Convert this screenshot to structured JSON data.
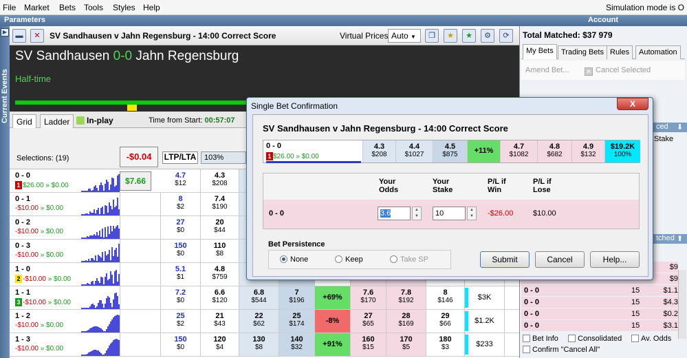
{
  "menu": [
    "File",
    "Market",
    "Bets",
    "Tools",
    "Styles",
    "Help"
  ],
  "menu_status": "Simulation mode is O",
  "panels": {
    "parameters": "Parameters",
    "account": "Account",
    "current_events": "Current Events"
  },
  "toolbar": {
    "title": "SV Sandhausen v Jahn Regensburg - 14:00 Correct Score",
    "virtual_prices_label": "Virtual Prices:",
    "virtual_prices_value": "Auto"
  },
  "event": {
    "home": "SV Sandhausen",
    "score": "0-0",
    "away": "Jahn Regensburg",
    "status": "Half-time"
  },
  "tabs": {
    "grid": "Grid",
    "ladder": "Ladder",
    "inplay": "In-play",
    "time_label": "Time from Start:",
    "time_value": "00:57:07"
  },
  "grid_header": {
    "selections": "Selections: (19)",
    "pl": "-$0.04",
    "ltp_lta": "LTP/LTA",
    "pct": "103%"
  },
  "rows": [
    {
      "name": "0 - 0",
      "badge": "1",
      "badge_color": "#cc0000",
      "pl_from": "$26.00",
      "pl_to": "$0.00",
      "pl_neg": false,
      "pbtn": "$7.66",
      "ltp": "4.7",
      "ltp_amt": "$12",
      "c1": "4.3",
      "c1a": "$208",
      "c2": "",
      "c2a": "",
      "c3": "",
      "c3a": "",
      "pct": "",
      "l1": "",
      "l1a": "",
      "l2": "",
      "l2a": "",
      "l3": "",
      "l3a": "",
      "matched": ""
    },
    {
      "name": "0 - 1",
      "badge": "",
      "pl_from": "-$10.00",
      "pl_to": "$0.00",
      "pl_neg": true,
      "ltp": "8",
      "ltp_amt": "$2",
      "c1": "7.4",
      "c1a": "$190",
      "matched": ""
    },
    {
      "name": "0 - 2",
      "badge": "",
      "pl_from": "-$10.00",
      "pl_to": "$0.00",
      "pl_neg": true,
      "ltp": "27",
      "ltp_amt": "$0",
      "c1": "20",
      "c1a": "$44",
      "matched": ""
    },
    {
      "name": "0 - 3",
      "badge": "",
      "pl_from": "-$10.00",
      "pl_to": "$0.00",
      "pl_neg": true,
      "ltp": "150",
      "ltp_amt": "$0",
      "c1": "110",
      "c1a": "$8",
      "matched": ""
    },
    {
      "name": "1 - 0",
      "badge": "2",
      "badge_color": "#ffe400",
      "pl_from": "-$10.00",
      "pl_to": "$0.00",
      "pl_neg": true,
      "ltp": "5.1",
      "ltp_amt": "$1",
      "c1": "4.8",
      "c1a": "$759",
      "matched": ""
    },
    {
      "name": "1 - 1",
      "badge": "3",
      "badge_color": "#1a9a1a",
      "pl_from": "-$10.00",
      "pl_to": "$0.00",
      "pl_neg": true,
      "ltp": "7.2",
      "ltp_amt": "$0",
      "c1": "6.6",
      "c1a": "$120",
      "c2": "6.8",
      "c2a": "$544",
      "c3": "7",
      "c3a": "$196",
      "pct": "+69%",
      "pct_type": "gr",
      "l1": "7.6",
      "l1a": "$170",
      "l2": "7.8",
      "l2a": "$192",
      "l3": "8",
      "l3a": "$146",
      "matched": "$3K"
    },
    {
      "name": "1 - 2",
      "badge": "",
      "pl_from": "-$10.00",
      "pl_to": "$0.00",
      "pl_neg": true,
      "ltp": "25",
      "ltp_amt": "$2",
      "c1": "21",
      "c1a": "$43",
      "c2": "22",
      "c2a": "$62",
      "c3": "25",
      "c3a": "$174",
      "pct": "-8%",
      "pct_type": "rd",
      "l1": "27",
      "l1a": "$65",
      "l2": "28",
      "l2a": "$169",
      "l3": "29",
      "l3a": "$66",
      "matched": "$1.2K"
    },
    {
      "name": "1 - 3",
      "badge": "",
      "pl_from": "-$10.00",
      "pl_to": "$0.00",
      "pl_neg": true,
      "ltp": "150",
      "ltp_amt": "$0",
      "c1": "120",
      "c1a": "$4",
      "c2": "130",
      "c2a": "$8",
      "c3": "140",
      "c3a": "$32",
      "pct": "+91%",
      "pct_type": "gr",
      "l1": "160",
      "l1a": "$15",
      "l2": "170",
      "l2a": "$5",
      "l3": "180",
      "l3a": "$3",
      "matched": "$233"
    }
  ],
  "account": {
    "total_matched": "Total Matched: $37 979",
    "tabs": [
      "My Bets",
      "Trading Bets",
      "Rules",
      "Automation"
    ],
    "amend": "Amend Bet...",
    "cancel_selected": "Cancel Selected",
    "unmatched_hdr": "ced",
    "stake_hdr": "Stake",
    "matched_hdr": "tched",
    "matched_rows": [
      {
        "n": "",
        "s": "",
        "p": "$9"
      },
      {
        "n": "",
        "s": "",
        "p": "$9"
      },
      {
        "n": "0 - 0",
        "s": "15",
        "p": "$1.1"
      },
      {
        "n": "0 - 0",
        "s": "15",
        "p": "$4.3"
      },
      {
        "n": "0 - 0",
        "s": "15",
        "p": "$0.2"
      },
      {
        "n": "0 - 0",
        "s": "15",
        "p": "$3.1"
      }
    ],
    "opts": {
      "bet_info": "Bet Info",
      "consolidated": "Consolidated",
      "av_odds": "Av. Odds",
      "confirm": "Confirm \"Cancel All\""
    }
  },
  "dialog": {
    "title": "Single Bet Confirmation",
    "close": "X",
    "market": "SV Sandhausen v Jahn Regensburg - 14:00 Correct Score",
    "ladder": {
      "name": "0 - 0",
      "badge": "1",
      "pl_from": "$26.00",
      "pl_to": "$0.00",
      "cells": [
        {
          "o": "4.3",
          "a": "$208",
          "t": "back"
        },
        {
          "o": "4.4",
          "a": "$1027",
          "t": "back"
        },
        {
          "o": "4.5",
          "a": "$875",
          "t": "bl"
        },
        {
          "o": "+11%",
          "a": "",
          "t": "gr"
        },
        {
          "o": "4.7",
          "a": "$1082",
          "t": "lay"
        },
        {
          "o": "4.8",
          "a": "$682",
          "t": "lay"
        },
        {
          "o": "4.9",
          "a": "$132",
          "t": "lay"
        },
        {
          "o": "$19.2K",
          "a": "100%",
          "t": "cy"
        }
      ]
    },
    "form": {
      "h_odds": "Your Odds",
      "h_stake": "Your Stake",
      "h_plwin": "P/L if Win",
      "h_pllose": "P/L if Lose",
      "sel": "0 - 0",
      "odds": "3.6",
      "stake": "10",
      "pl_win": "-$26.00",
      "pl_lose": "$10.00"
    },
    "persistence": {
      "label": "Bet Persistence",
      "none": "None",
      "keep": "Keep",
      "sp": "Take SP"
    },
    "buttons": {
      "submit": "Submit",
      "cancel": "Cancel",
      "help": "Help..."
    }
  }
}
